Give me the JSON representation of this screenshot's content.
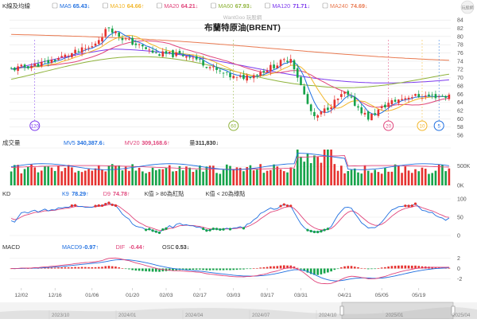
{
  "app": {
    "watermark": "WantGoo 玩股網",
    "corner_logo": "玩股網"
  },
  "colors": {
    "up": "#e5322f",
    "down": "#16a34a",
    "ma5": "#1f6fe0",
    "ma10": "#f2b62a",
    "ma20": "#e0457b",
    "ma60": "#8fb33b",
    "ma120": "#7c3aed",
    "ma240": "#e97a51",
    "grid": "#e7e7e7",
    "axis_text": "#555555"
  },
  "price_panel": {
    "title": "K線及均線",
    "legend": [
      {
        "label": "MA5",
        "value": "65.43",
        "arrow": "↓",
        "color": "#1f6fe0"
      },
      {
        "label": "MA10",
        "value": "64.66",
        "arrow": "↑",
        "color": "#f2b62a"
      },
      {
        "label": "MA20",
        "value": "64.21",
        "arrow": "↓",
        "color": "#e0457b"
      },
      {
        "label": "MA60",
        "value": "67.93",
        "arrow": "↓",
        "color": "#8fb33b"
      },
      {
        "label": "MA120",
        "value": "71.71",
        "arrow": "↓",
        "color": "#7c3aed"
      },
      {
        "label": "MA240",
        "value": "74.69",
        "arrow": "↓",
        "color": "#e97a51"
      }
    ],
    "chart_title": "布蘭特原油(BRENT)",
    "markers": [
      {
        "label": "120",
        "color": "#7c3aed",
        "x_index": 7
      },
      {
        "label": "60",
        "color": "#8fb33b",
        "x_index": 66
      },
      {
        "label": "20",
        "color": "#e0457b",
        "x_index": 112
      },
      {
        "label": "10",
        "color": "#f2b62a",
        "x_index": 122
      },
      {
        "label": "5",
        "color": "#1f6fe0",
        "x_index": 127
      }
    ]
  },
  "volume_panel": {
    "title": "成交量",
    "legend": [
      {
        "label": "MV5",
        "value": "340,387.6",
        "arrow": "↓",
        "color": "#1f6fe0"
      },
      {
        "label": "MV20",
        "value": "309,168.6",
        "arrow": "↑",
        "color": "#e0457b"
      },
      {
        "label": "量",
        "value": "311,830",
        "arrow": "↓",
        "color": "#333333"
      }
    ]
  },
  "kd_panel": {
    "title": "KD",
    "legend": [
      {
        "label": "K9",
        "value": "78.29",
        "arrow": "↑",
        "color": "#1f6fe0"
      },
      {
        "label": "D9",
        "value": "74.78",
        "arrow": "↑",
        "color": "#e0457b"
      },
      {
        "label": "K值 > 80為紅點",
        "value": "",
        "arrow": "",
        "color": "#333333"
      },
      {
        "label": "K值 < 20為綠點",
        "value": "",
        "arrow": "",
        "color": "#333333"
      }
    ]
  },
  "macd_panel": {
    "title": "MACD",
    "legend": [
      {
        "label": "MACD9",
        "value": "-0.97",
        "arrow": "↑",
        "color": "#1f6fe0"
      },
      {
        "label": "DIF",
        "value": "-0.44",
        "arrow": "↑",
        "color": "#e0457b"
      },
      {
        "label": "OSC",
        "value": "0.53",
        "arrow": "↓",
        "color": "#333333"
      }
    ]
  },
  "x_axis": {
    "date_labels": [
      "12/02",
      "12/16",
      "01/06",
      "01/20",
      "02/03",
      "02/17",
      "03/03",
      "03/17",
      "03/31",
      "04/21",
      "05/05",
      "05/19"
    ],
    "navigator_labels": [
      "2023/10",
      "2024/01",
      "2024/04",
      "2024/07",
      "2024/10",
      "2025/01",
      "2025/04"
    ]
  },
  "chart_data": [
    {
      "type": "candlestick",
      "title": "布蘭特原油(BRENT)",
      "y_axis_ticks": [
        56,
        58,
        60,
        62,
        64,
        66,
        68,
        70,
        72,
        74,
        76,
        78,
        80,
        82,
        84
      ],
      "ylim": [
        56,
        85
      ],
      "x_tick_labels": [
        "12/02",
        "12/16",
        "01/06",
        "01/20",
        "02/03",
        "02/17",
        "03/03",
        "03/17",
        "03/31",
        "04/21",
        "05/05",
        "05/19"
      ],
      "close_path": [
        {
          "t": "12/02",
          "close": 72.0
        },
        {
          "t": "12/16",
          "close": 73.6
        },
        {
          "t": "01/06",
          "close": 77.5
        },
        {
          "t": "01/14",
          "close": 82.3
        },
        {
          "t": "01/20",
          "close": 79.6
        },
        {
          "t": "02/03",
          "close": 75.8
        },
        {
          "t": "02/17",
          "close": 75.4
        },
        {
          "t": "03/03",
          "close": 71.2
        },
        {
          "t": "03/10",
          "close": 69.8
        },
        {
          "t": "03/17",
          "close": 71.0
        },
        {
          "t": "03/31",
          "close": 74.8
        },
        {
          "t": "04/07",
          "close": 63.5
        },
        {
          "t": "04/09",
          "close": 60.0
        },
        {
          "t": "04/21",
          "close": 66.2
        },
        {
          "t": "05/05",
          "close": 60.2
        },
        {
          "t": "05/12",
          "close": 63.8
        },
        {
          "t": "05/19",
          "close": 65.5
        }
      ],
      "series": [
        {
          "name": "MA5",
          "last": 65.43
        },
        {
          "name": "MA10",
          "last": 64.66
        },
        {
          "name": "MA20",
          "last": 64.21
        },
        {
          "name": "MA60",
          "last": 67.93
        },
        {
          "name": "MA120",
          "last": 71.71
        },
        {
          "name": "MA240",
          "last": 74.69
        }
      ]
    },
    {
      "type": "bar",
      "title": "成交量",
      "y_axis_ticks": [
        "0K",
        "500K"
      ],
      "series": [
        {
          "name": "MV5",
          "last": 340387.6
        },
        {
          "name": "MV20",
          "last": 309168.6
        },
        {
          "name": "量",
          "last": 311830
        }
      ]
    },
    {
      "type": "line",
      "title": "KD",
      "y_axis_ticks": [
        0,
        50,
        100
      ],
      "ylim": [
        0,
        100
      ],
      "series": [
        {
          "name": "K9",
          "last": 78.29
        },
        {
          "name": "D9",
          "last": 74.78
        }
      ]
    },
    {
      "type": "line",
      "title": "MACD",
      "y_axis_ticks": [
        -2,
        0,
        2
      ],
      "ylim": [
        -3,
        3
      ],
      "series": [
        {
          "name": "MACD9",
          "last": -0.97
        },
        {
          "name": "DIF",
          "last": -0.44
        },
        {
          "name": "OSC",
          "last": 0.53
        }
      ]
    }
  ]
}
